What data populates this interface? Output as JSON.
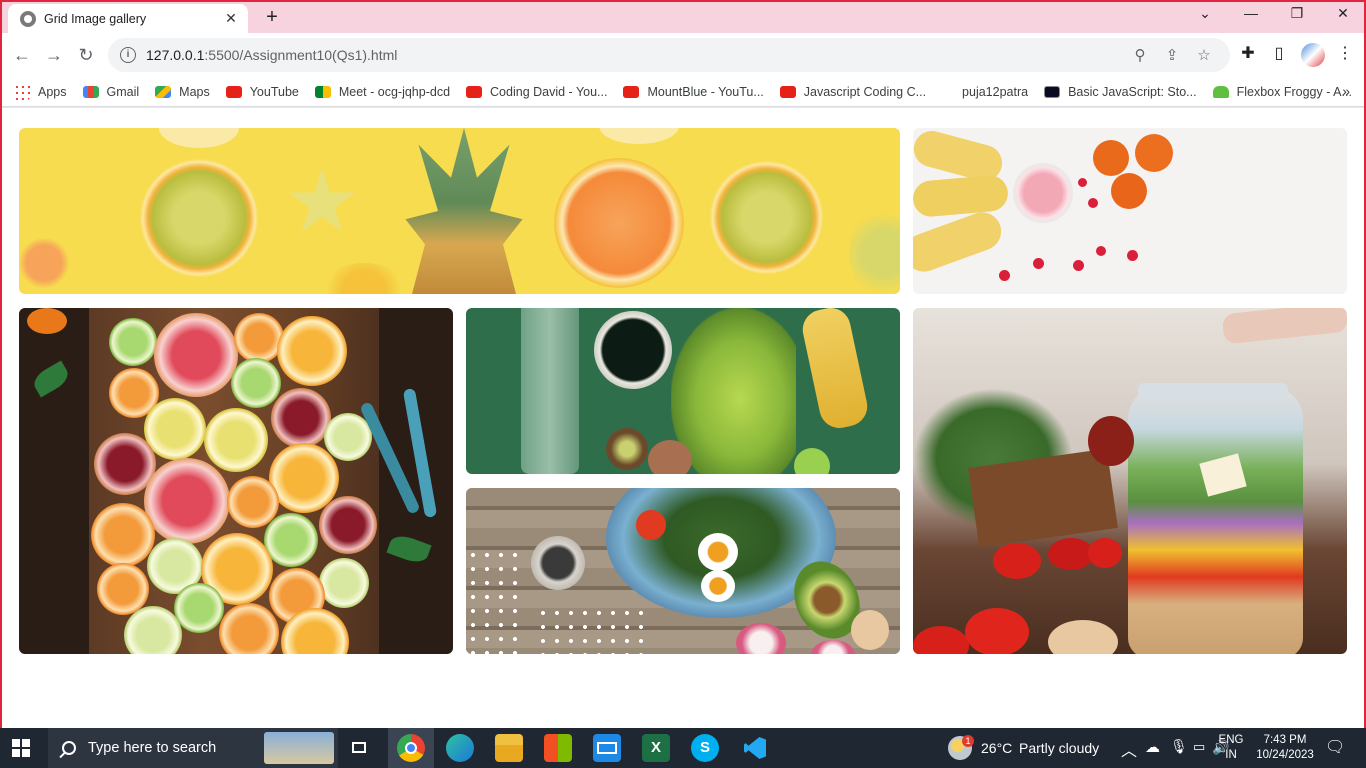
{
  "browser": {
    "tab_title": "Grid Image gallery",
    "tab_close_icon": "close-icon",
    "new_tab_symbol": "+",
    "window_controls": [
      "⌄",
      "—",
      "❐",
      "✕"
    ],
    "url_host": "127.0.0.1",
    "url_path": ":5500/Assignment10(Qs1).html"
  },
  "bookmarks": [
    {
      "label": "Apps",
      "icon": "apps-icon"
    },
    {
      "label": "Gmail",
      "icon": "gmail-icon"
    },
    {
      "label": "Maps",
      "icon": "maps-icon"
    },
    {
      "label": "YouTube",
      "icon": "youtube-icon"
    },
    {
      "label": "Meet - ocg-jqhp-dcd",
      "icon": "meet-icon"
    },
    {
      "label": "Coding David - You...",
      "icon": "youtube-icon"
    },
    {
      "label": "MountBlue - YouTu...",
      "icon": "youtube-icon"
    },
    {
      "label": "Javascript Coding C...",
      "icon": "youtube-icon"
    },
    {
      "label": "puja12patra",
      "icon": "none"
    },
    {
      "label": "Basic JavaScript: Sto...",
      "icon": "freecodecamp-icon"
    },
    {
      "label": "Flexbox Froggy - A...",
      "icon": "froggy-icon"
    }
  ],
  "gallery": {
    "images": [
      {
        "subject": "citrus-banner-image"
      },
      {
        "subject": "smoothie-image"
      },
      {
        "subject": "citrus-board-image"
      },
      {
        "subject": "greens-image"
      },
      {
        "subject": "salad-bowl-image"
      },
      {
        "subject": "jar-salad-image"
      }
    ]
  },
  "taskbar": {
    "search_placeholder": "Type here to search",
    "weather_temp": "26°C",
    "weather_desc": "Partly cloudy",
    "weather_badge": "1",
    "lang_line1": "ENG",
    "lang_line2": "IN",
    "time": "7:43 PM",
    "date": "10/24/2023"
  }
}
